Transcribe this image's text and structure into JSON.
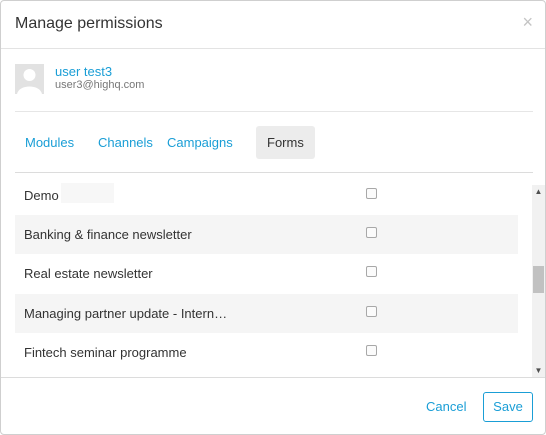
{
  "dialog": {
    "title": "Manage permissions",
    "close_icon": "close-icon",
    "close_glyph": "×"
  },
  "user": {
    "name": "user test3",
    "email": "user3@highq.com",
    "avatar_icon": "user-avatar-placeholder-icon"
  },
  "tabs": [
    {
      "label": "Modules",
      "active": false
    },
    {
      "label": "Channels",
      "active": false
    },
    {
      "label": "Campaigns",
      "active": false
    },
    {
      "label": "Forms",
      "active": true
    }
  ],
  "forms": [
    {
      "label": "Demo",
      "checked": false
    },
    {
      "label": "Banking & finance newsletter",
      "checked": false
    },
    {
      "label": "Real estate newsletter",
      "checked": false
    },
    {
      "label": "Managing partner update - Intern…",
      "checked": false
    },
    {
      "label": "Fintech seminar programme",
      "checked": false
    }
  ],
  "scrollbar": {
    "up_glyph": "▲",
    "down_glyph": "▼",
    "position_fraction": 0.55
  },
  "footer": {
    "cancel_label": "Cancel",
    "save_label": "Save"
  },
  "colors": {
    "accent": "#1a9ed6",
    "text": "#333333",
    "muted": "#777777",
    "row_shade": "#f5f5f5"
  }
}
